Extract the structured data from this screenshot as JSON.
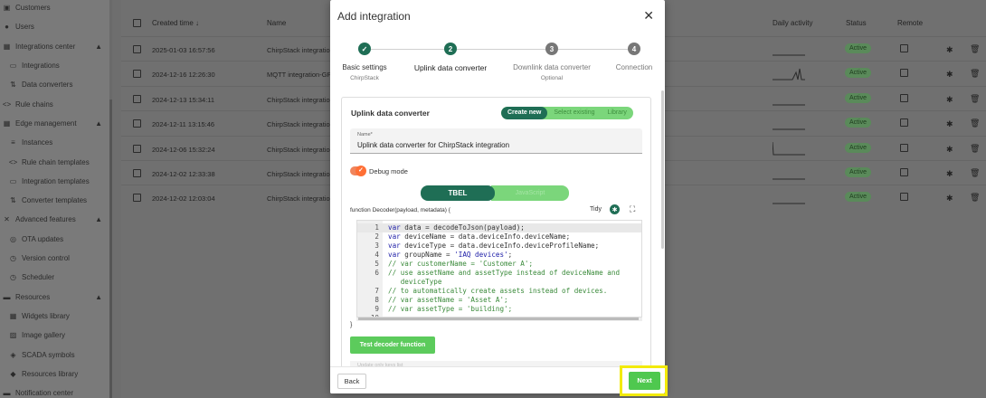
{
  "sidebar": {
    "items": [
      {
        "label": "Customers",
        "icon": "customers-icon",
        "glyph": "▣"
      },
      {
        "label": "Users",
        "icon": "users-icon",
        "glyph": "●"
      },
      {
        "label": "Integrations center",
        "icon": "integrations-center-icon",
        "glyph": "▦",
        "expanded": true
      },
      {
        "label": "Integrations",
        "icon": "integrations-icon",
        "glyph": "▭",
        "child": true
      },
      {
        "label": "Data converters",
        "icon": "data-converters-icon",
        "glyph": "⇅",
        "child": true
      },
      {
        "label": "Rule chains",
        "icon": "rule-chains-icon",
        "glyph": "<>"
      },
      {
        "label": "Edge management",
        "icon": "edge-management-icon",
        "glyph": "▦",
        "expanded": true
      },
      {
        "label": "Instances",
        "icon": "instances-icon",
        "glyph": "≡",
        "child": true
      },
      {
        "label": "Rule chain templates",
        "icon": "rule-chain-templates-icon",
        "glyph": "<>",
        "child": true
      },
      {
        "label": "Integration templates",
        "icon": "integration-templates-icon",
        "glyph": "▭",
        "child": true
      },
      {
        "label": "Converter templates",
        "icon": "converter-templates-icon",
        "glyph": "⇅",
        "child": true
      },
      {
        "label": "Advanced features",
        "icon": "advanced-features-icon",
        "glyph": "✕",
        "expanded": true
      },
      {
        "label": "OTA updates",
        "icon": "ota-updates-icon",
        "glyph": "◎",
        "child": true
      },
      {
        "label": "Version control",
        "icon": "version-control-icon",
        "glyph": "◷",
        "child": true
      },
      {
        "label": "Scheduler",
        "icon": "scheduler-icon",
        "glyph": "◷",
        "child": true
      },
      {
        "label": "Resources",
        "icon": "resources-icon",
        "glyph": "▬",
        "expanded": true
      },
      {
        "label": "Widgets library",
        "icon": "widgets-library-icon",
        "glyph": "▦",
        "child": true
      },
      {
        "label": "Image gallery",
        "icon": "image-gallery-icon",
        "glyph": "▨",
        "child": true
      },
      {
        "label": "SCADA symbols",
        "icon": "scada-symbols-icon",
        "glyph": "◈",
        "child": true
      },
      {
        "label": "Resources library",
        "icon": "resources-library-icon",
        "glyph": "◆",
        "child": true
      },
      {
        "label": "Notification center",
        "icon": "notification-center-icon",
        "glyph": "▬"
      }
    ]
  },
  "table": {
    "headers": {
      "created": "Created time ↓",
      "name": "Name",
      "activity": "Daily activity",
      "status": "Status",
      "remote": "Remote"
    },
    "rows": [
      {
        "created": "2025-01-03 16:57:56",
        "name": "ChirpStack integration-",
        "status": "Active"
      },
      {
        "created": "2024-12-16 12:26:30",
        "name": "MQTT integration-GPS",
        "status": "Active"
      },
      {
        "created": "2024-12-13 15:34:11",
        "name": "ChirpStack integration-",
        "status": "Active"
      },
      {
        "created": "2024-12-11 13:15:46",
        "name": "ChirpStack integration-",
        "status": "Active"
      },
      {
        "created": "2024-12-06 15:32:24",
        "name": "ChirpStack integration-",
        "status": "Active"
      },
      {
        "created": "2024-12-02 12:33:38",
        "name": "ChirpStack integration-",
        "status": "Active"
      },
      {
        "created": "2024-12-02 12:03:04",
        "name": "ChirpStack integration",
        "status": "Active"
      }
    ]
  },
  "modal": {
    "title": "Add integration",
    "steps": [
      {
        "number": "✓",
        "label": "Basic settings",
        "sub": "ChirpStack",
        "state": "done"
      },
      {
        "number": "2",
        "label": "Uplink data converter",
        "sub": "",
        "state": "active"
      },
      {
        "number": "3",
        "label": "Downlink data converter",
        "sub": "Optional",
        "state": "pending"
      },
      {
        "number": "4",
        "label": "Connection",
        "sub": "",
        "state": "pending"
      }
    ],
    "panel_title": "Uplink data converter",
    "segments": [
      "Create new",
      "Select existing",
      "Library"
    ],
    "name_label": "Name*",
    "name_value": "Uplink data converter for ChirpStack integration",
    "debug_label": "Debug mode",
    "lang_tbel": "TBEL",
    "lang_js": "JavaScript",
    "fn_signature": "function Decoder(payload, metadata) {",
    "tidy": "Tidy",
    "close_brace": "}",
    "test_button": "Test decoder function",
    "faded_label": "Update only keys list",
    "back": "Back",
    "next": "Next"
  },
  "code_lines": [
    {
      "n": "1",
      "parts": [
        [
          "kw",
          "var"
        ],
        [
          "",
          "data = decodeToJson(payload);"
        ]
      ]
    },
    {
      "n": "2",
      "parts": [
        [
          "kw",
          "var"
        ],
        [
          "",
          "deviceName = data.deviceInfo.deviceName;"
        ]
      ]
    },
    {
      "n": "3",
      "parts": [
        [
          "kw",
          "var"
        ],
        [
          "",
          "deviceType = data.deviceInfo.deviceProfileName;"
        ]
      ]
    },
    {
      "n": "4",
      "parts": [
        [
          "kw",
          "var"
        ],
        [
          "",
          "groupName = "
        ],
        [
          "str",
          "'IAQ devices'"
        ],
        [
          "",
          ";"
        ]
      ]
    },
    {
      "n": "5",
      "parts": [
        [
          "cm",
          "// var customerName = 'Customer A';"
        ]
      ]
    },
    {
      "n": "6",
      "parts": [
        [
          "cm",
          "// use assetName and assetType instead of deviceName and"
        ]
      ]
    },
    {
      "n": "",
      "parts": [
        [
          "cm",
          "   deviceType"
        ]
      ]
    },
    {
      "n": "7",
      "parts": [
        [
          "cm",
          "// to automatically create assets instead of devices."
        ]
      ]
    },
    {
      "n": "8",
      "parts": [
        [
          "cm",
          "// var assetName = 'Asset A';"
        ]
      ]
    },
    {
      "n": "9",
      "parts": [
        [
          "cm",
          "// var assetType = 'building';"
        ]
      ]
    },
    {
      "n": "10",
      "parts": [
        [
          "",
          ""
        ]
      ]
    }
  ],
  "colors": {
    "primary": "#1f6e55",
    "accent_green": "#5ccb5c",
    "toggle_orange": "#ff6f35",
    "highlight": "#f2ea0a"
  }
}
